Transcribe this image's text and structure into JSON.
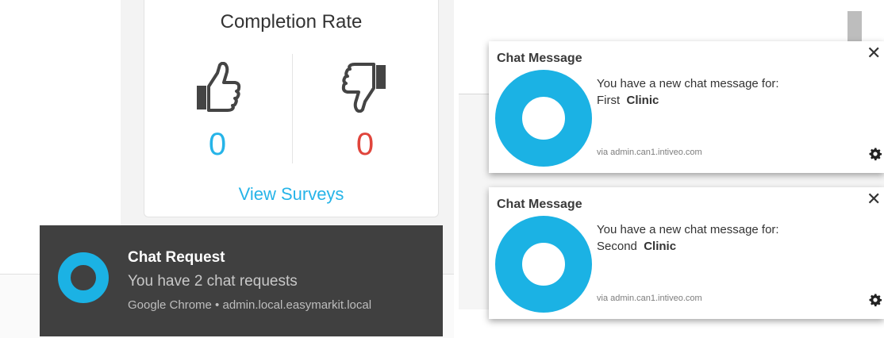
{
  "survey_card": {
    "title": "Completion Rate",
    "thumbs_up_count": "0",
    "thumbs_down_count": "0",
    "link_label": "View Surveys",
    "colors": {
      "positive": "#26b4e8",
      "negative": "#e0453c"
    }
  },
  "chrome_toast": {
    "title": "Chat Request",
    "body": "You have 2 chat requests",
    "source": "Google Chrome • admin.local.easymarkit.local",
    "icon": "ring-logo-icon",
    "accent": "#1bb2e4",
    "background": "#404040"
  },
  "notifications": [
    {
      "title": "Chat Message",
      "line1": "You have a new chat message for:",
      "line2_prefix": "First",
      "line2_bold": "Clinic",
      "source": "via admin.can1.intiveo.com",
      "close_icon": "close-icon",
      "settings_icon": "gear-icon"
    },
    {
      "title": "Chat Message",
      "line1": "You have a new chat message for:",
      "line2_prefix": "Second",
      "line2_bold": "Clinic",
      "source": "via admin.can1.intiveo.com",
      "close_icon": "close-icon",
      "settings_icon": "gear-icon"
    }
  ],
  "brand_color": "#1bb2e4"
}
